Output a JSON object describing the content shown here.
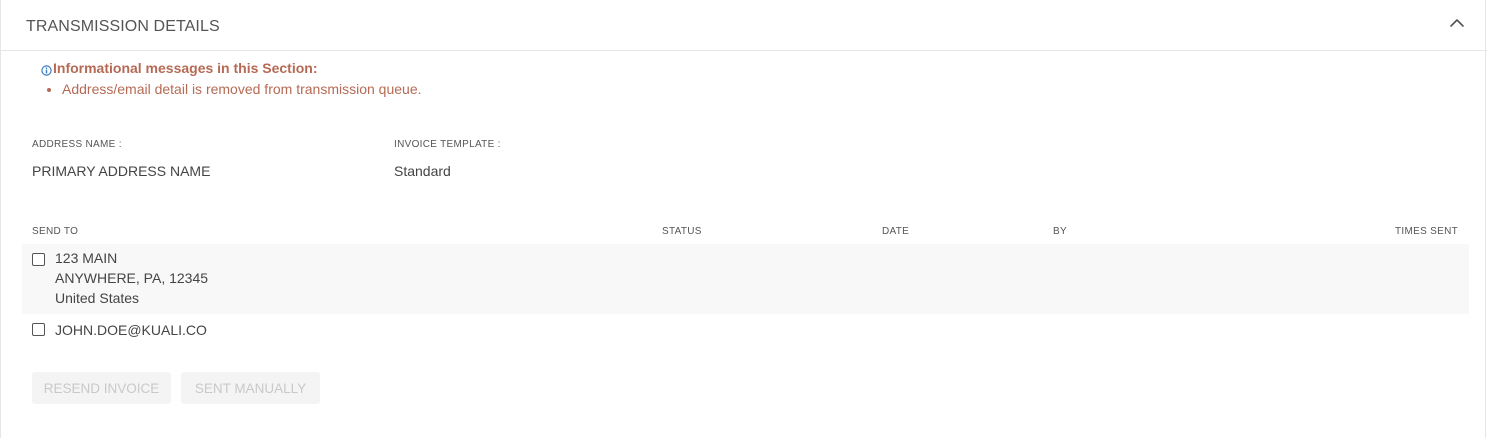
{
  "section": {
    "title": "TRANSMISSION DETAILS"
  },
  "icons": {
    "collapse": "chevron-up-icon",
    "info": "info-circle-icon"
  },
  "colors": {
    "info_text": "#b66a55",
    "info_icon": "#3b7bbf",
    "disabled_text": "#c9c9c9"
  },
  "info": {
    "heading": "Informational messages in this Section:",
    "messages": [
      "Address/email detail is removed from transmission queue."
    ]
  },
  "fields": {
    "address_name_label": "ADDRESS NAME :",
    "address_name_value": "PRIMARY ADDRESS NAME",
    "invoice_template_label": "INVOICE TEMPLATE :",
    "invoice_template_value": "Standard"
  },
  "table": {
    "columns": [
      "SEND TO",
      "STATUS",
      "DATE",
      "BY",
      "TIMES SENT"
    ],
    "rows": [
      {
        "checked": false,
        "send_to": [
          "123 MAIN",
          "ANYWHERE, PA, 12345",
          "United States"
        ]
      },
      {
        "checked": false,
        "send_to": [
          "JOHN.DOE@KUALI.CO"
        ]
      }
    ]
  },
  "actions": {
    "resend_label": "RESEND INVOICE",
    "sent_manually_label": "SENT MANUALLY"
  }
}
